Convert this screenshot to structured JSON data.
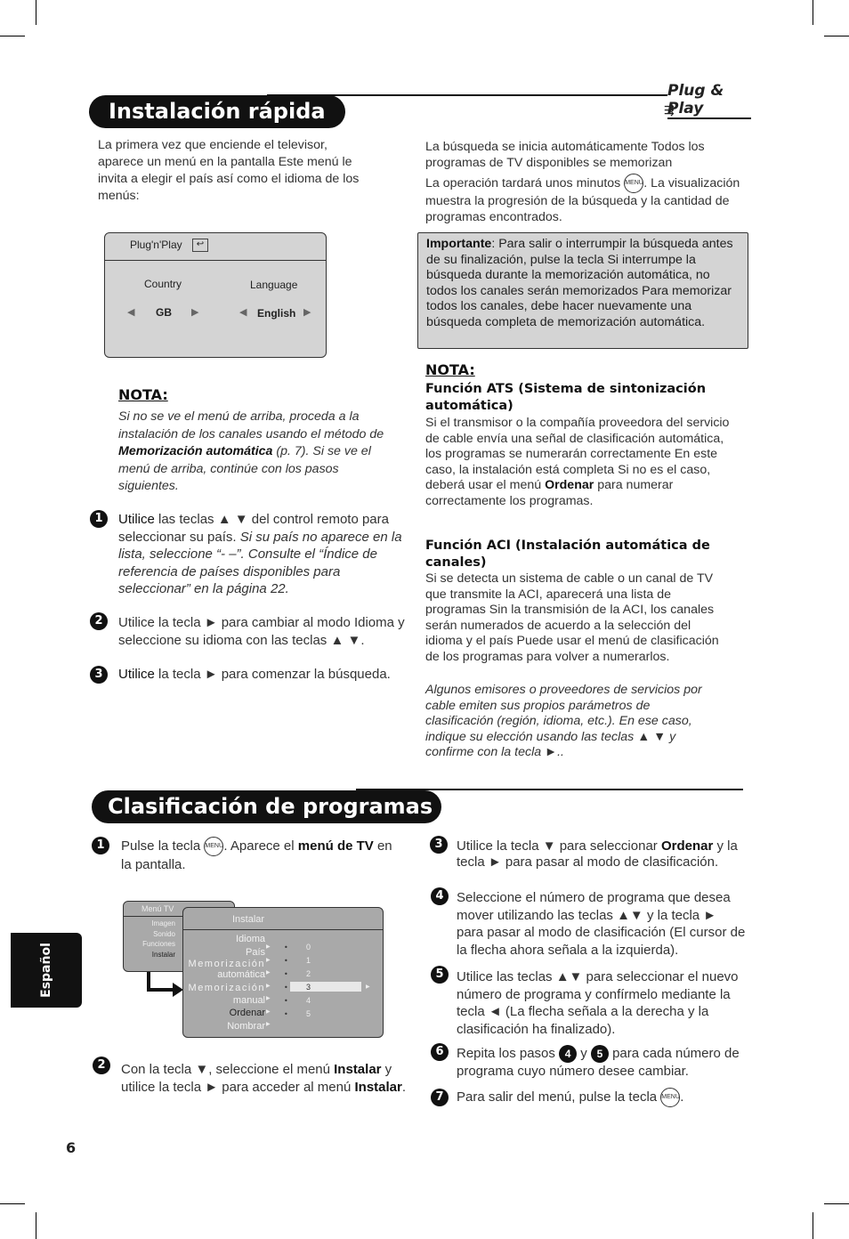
{
  "section1": {
    "title": "Instalación rápida",
    "logo": "Plug & Play",
    "intro": "La primera vez que enciende el televisor, aparece un menú en la pantalla Este menú le invita a elegir el país así como el idioma de los menús:",
    "osd": {
      "title": "Plug'n'Play",
      "country_label": "Country",
      "country_value": "GB",
      "language_label": "Language",
      "language_value": "English"
    },
    "nota_label": "NOTA:",
    "nota_text": [
      {
        "t": "Si no se ve el menú de arriba, proceda a la instalación de los canales usando el método de ",
        "i": true
      },
      {
        "t": "Memorización automática",
        "b": true
      },
      {
        "t": " (p. 7). Si se ve el menú de arriba, continúe con los pasos siguientes.",
        "i": true
      }
    ],
    "steps": [
      {
        "n": "1",
        "runs": [
          {
            "t": "Utilice",
            "b": false,
            "dark": true
          },
          {
            "t": " las teclas ▲ ▼ del control remoto para seleccionar su país. "
          },
          {
            "t": "Si su país no aparece en la lista, seleccione “- –”. Consulte el “Índice de referencia de países disponibles para seleccionar” en la página 22.",
            "i": true
          }
        ]
      },
      {
        "n": "2",
        "runs": [
          {
            "t": "Utilice la tecla ► para cambiar al modo Idioma y seleccione su idioma con las teclas ▲ ▼."
          }
        ]
      },
      {
        "n": "3",
        "runs": [
          {
            "t": "Utilice",
            "dark": true
          },
          {
            "t": " la tecla ► para comenzar la búsqueda."
          }
        ]
      }
    ],
    "right_p1": "La búsqueda se inicia automáticamente Todos los programas de TV disponibles se memorizan",
    "right_p2a": "La operación tardará unos minutos",
    "right_p2b": ". La visualización muestra la progresión de la búsqueda y la cantidad de programas encontrados.",
    "menu_key": "MENU",
    "importante": [
      {
        "t": "Importante",
        "b": true
      },
      {
        "t": ": Para salir o interrumpir la búsqueda antes de su finalización, pulse la tecla Si interrumpe la búsqueda durante la memorización automática, no todos los canales serán memorizados Para memorizar todos los canales, debe hacer nuevamente una búsqueda completa de memorización automática."
      }
    ],
    "nota2_label": "NOTA:",
    "ats_title": "Función ATS (Sistema de sintonización automática)",
    "ats_text": [
      {
        "t": "Si el transmisor o la compañía proveedora del servicio de cable envía una señal de clasificación automática, los programas se numerarán correctamente En este caso, la instalación está completa Si no es el caso, deberá usar el menú "
      },
      {
        "t": "Ordenar",
        "b": true
      },
      {
        "t": " para numerar correctamente los programas."
      }
    ],
    "aci_title": "Función ACI (Instalación automática de canales)",
    "aci_text": "Si se detecta un sistema de cable o un canal de TV que transmite la ACI, aparecerá una lista de programas Sin la transmisión de la ACI, los canales serán numerados de acuerdo a la selección del idioma y el país Puede usar el menú de clasificación de los programas para volver a numerarlos.",
    "aci_italic": "Algunos emisores o proveedores de servicios por cable emiten sus propios parámetros de clasificación (región, idioma, etc.). En ese caso, indique su elección usando las teclas ▲ ▼ y confirme con la tecla ►.."
  },
  "section2": {
    "title": "Clasificación de programas",
    "step1": [
      {
        "t": "Pulse la tecla "
      },
      {
        "key": true
      },
      {
        "t": ". Aparece el "
      },
      {
        "t": "menú de TV",
        "b": true
      },
      {
        "t": " en la pantalla."
      }
    ],
    "step2": [
      {
        "t": "Con la tecla ▼, seleccione el menú "
      },
      {
        "t": "Instalar",
        "b": true
      },
      {
        "t": " y utilice la tecla ► para acceder al menú "
      },
      {
        "t": "Instalar",
        "b": true
      },
      {
        "t": "."
      }
    ],
    "step3": [
      {
        "t": "Utilice la tecla ▼ para seleccionar "
      },
      {
        "t": "Ordenar",
        "b": true
      },
      {
        "t": " y la tecla ► para pasar al modo de clasificación."
      }
    ],
    "step4": [
      {
        "t": "Seleccione el número de programa que desea mover utilizando las teclas ▲▼ y la tecla ► para pasar al modo de clasificación (El cursor de la flecha ahora señala a la izquierda)."
      }
    ],
    "step5": [
      {
        "t": "Utilice las teclas ▲▼ para seleccionar el nuevo número de programa y confírmelo mediante la tecla ◄ (La flecha señala a la derecha y la clasificación ha finalizado)."
      }
    ],
    "step6": [
      {
        "t": "Repita los pasos "
      },
      {
        "num": "4"
      },
      {
        "t": " y "
      },
      {
        "num": "5"
      },
      {
        "t": " para cada número de programa cuyo número desee cambiar."
      }
    ],
    "step7": [
      {
        "t": "Para salir del menú, pulse la tecla "
      },
      {
        "key": true
      },
      {
        "t": "."
      }
    ],
    "menu": {
      "back_title": "Menú TV",
      "back_items": [
        "Imagen",
        "Sonido",
        "Funciones",
        "Instalar"
      ],
      "front_title": "Instalar",
      "front_items": [
        "Idioma",
        "País",
        "Memorización",
        "automática",
        "Memorización",
        "manual",
        "Ordenar",
        "Nombrar"
      ],
      "numbers": [
        "0",
        "1",
        "2",
        "3",
        "4",
        "5"
      ],
      "selected": "3"
    }
  },
  "side_tab": "Español",
  "page_number": "6",
  "colors": {
    "ink": "#111111",
    "panel": "#d4d4d4",
    "menu_panel": "#a9a9a9"
  }
}
